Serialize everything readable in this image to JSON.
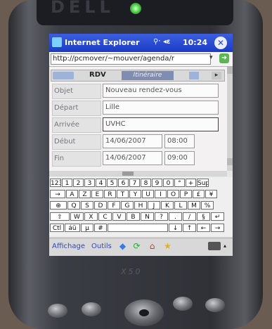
{
  "device": {
    "brand": "DELL",
    "model": "X50"
  },
  "titlebar": {
    "app_title": "Internet Explorer",
    "status_icons": "⚲ᐧ ◂ɛ",
    "clock": "10:24",
    "close_glyph": "✕"
  },
  "addressbar": {
    "url": "http://pcmover/~mouver/agenda/r",
    "dropdown_glyph": "▾",
    "go_glyph": "➜"
  },
  "tabs": {
    "rdv": "RDV",
    "itineraire": "Itinéraire",
    "scroll_glyph": "▸"
  },
  "form": {
    "objet_label": "Objet",
    "objet_value": "Nouveau rendez-vous",
    "depart_label": "Départ",
    "depart_value": "Lille",
    "arrivee_label": "Arrivée",
    "arrivee_value": "UVHC",
    "debut_label": "Début",
    "debut_date": "14/06/2007",
    "debut_time": "08:00",
    "fin_label": "Fin",
    "fin_date": "14/06/2007",
    "fin_time": "09:00"
  },
  "keyboard": {
    "rows": [
      [
        "123",
        "1",
        "2",
        "3",
        "4",
        "5",
        "6",
        "7",
        "8",
        "9",
        "0",
        "°",
        "+",
        "Sup"
      ],
      [
        "→",
        "A",
        "Z",
        "E",
        "R",
        "T",
        "Y",
        "U",
        "I",
        "O",
        "P",
        "£",
        "¥"
      ],
      [
        "⊕",
        "Q",
        "S",
        "D",
        "F",
        "G",
        "H",
        "J",
        "K",
        "L",
        "M",
        "%"
      ],
      [
        "⇧",
        "W",
        "X",
        "C",
        "V",
        "B",
        "N",
        "?",
        ".",
        "/",
        "§",
        "↵"
      ],
      [
        "Ctl",
        "áü",
        "µ",
        "#",
        "",
        "↓",
        "↑",
        "←",
        "→"
      ]
    ]
  },
  "bottombar": {
    "affichage": "Affichage",
    "outils": "Outils",
    "icons": [
      "back-icon",
      "refresh-icon",
      "home-icon",
      "favorites-icon"
    ]
  }
}
